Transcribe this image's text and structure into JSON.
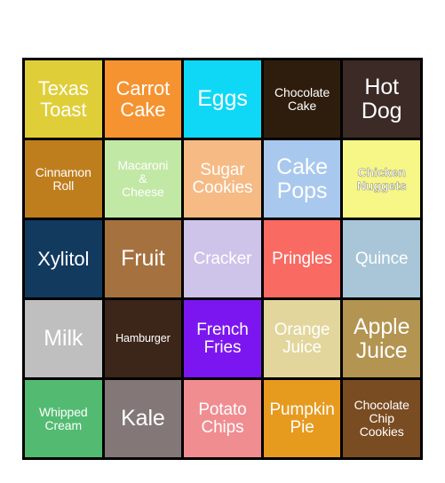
{
  "card": {
    "type": "bingo-card",
    "rows": 5,
    "columns": 5,
    "background_color": "#ffffff",
    "border_color": "#000000",
    "text_color": "#ffffff",
    "cells": [
      {
        "label": "Texas\nToast",
        "color": "#E0CE39",
        "size": "lg",
        "bold": false
      },
      {
        "label": "Carrot\nCake",
        "color": "#F59331",
        "size": "lg",
        "bold": false
      },
      {
        "label": "Eggs",
        "color": "#0ED8F5",
        "size": "xl",
        "bold": false
      },
      {
        "label": "Chocolate\nCake",
        "color": "#2E1D0D",
        "size": "sm",
        "bold": false
      },
      {
        "label": "Hot\nDog",
        "color": "#3B2A25",
        "size": "xl",
        "bold": false
      },
      {
        "label": "Cinnamon\nRoll",
        "color": "#BF7E1E",
        "size": "sm",
        "bold": false
      },
      {
        "label": "Macaroni\n&\nCheese",
        "color": "#C2E8A5",
        "size": "sm",
        "bold": false
      },
      {
        "label": "Sugar\nCookies",
        "color": "#F6BA85",
        "size": "md",
        "bold": false
      },
      {
        "label": "Cake\nPops",
        "color": "#A8C8EE",
        "size": "xl",
        "bold": false
      },
      {
        "label": "Chicken\nNuggets",
        "color": "#F7F787",
        "size": "sm",
        "bold": true
      },
      {
        "label": "Xylitol",
        "color": "#123A5E",
        "size": "lg",
        "bold": false
      },
      {
        "label": "Fruit",
        "color": "#A5713F",
        "size": "xl",
        "bold": false
      },
      {
        "label": "Cracker",
        "color": "#CEC3E8",
        "size": "md",
        "bold": false
      },
      {
        "label": "Pringles",
        "color": "#F96A62",
        "size": "md",
        "bold": false
      },
      {
        "label": "Quince",
        "color": "#A8C6D8",
        "size": "md",
        "bold": false
      },
      {
        "label": "Milk",
        "color": "#BFBFBF",
        "size": "xl",
        "bold": false
      },
      {
        "label": "Hamburger",
        "color": "#3B2619",
        "size": "xs",
        "bold": false
      },
      {
        "label": "French\nFries",
        "color": "#7B16F0",
        "size": "md",
        "bold": false
      },
      {
        "label": "Orange\nJuice",
        "color": "#E2D69C",
        "size": "md",
        "bold": false
      },
      {
        "label": "Apple\nJuice",
        "color": "#B39450",
        "size": "xl",
        "bold": false
      },
      {
        "label": "Whipped\nCream",
        "color": "#52BB71",
        "size": "sm",
        "bold": false
      },
      {
        "label": "Kale",
        "color": "#837877",
        "size": "xl",
        "bold": false
      },
      {
        "label": "Potato\nChips",
        "color": "#F08D91",
        "size": "md",
        "bold": false
      },
      {
        "label": "Pumpkin\nPie",
        "color": "#E69A1E",
        "size": "md",
        "bold": false
      },
      {
        "label": "Chocolate\nChip\nCookies",
        "color": "#7A4C22",
        "size": "sm",
        "bold": false
      }
    ]
  }
}
